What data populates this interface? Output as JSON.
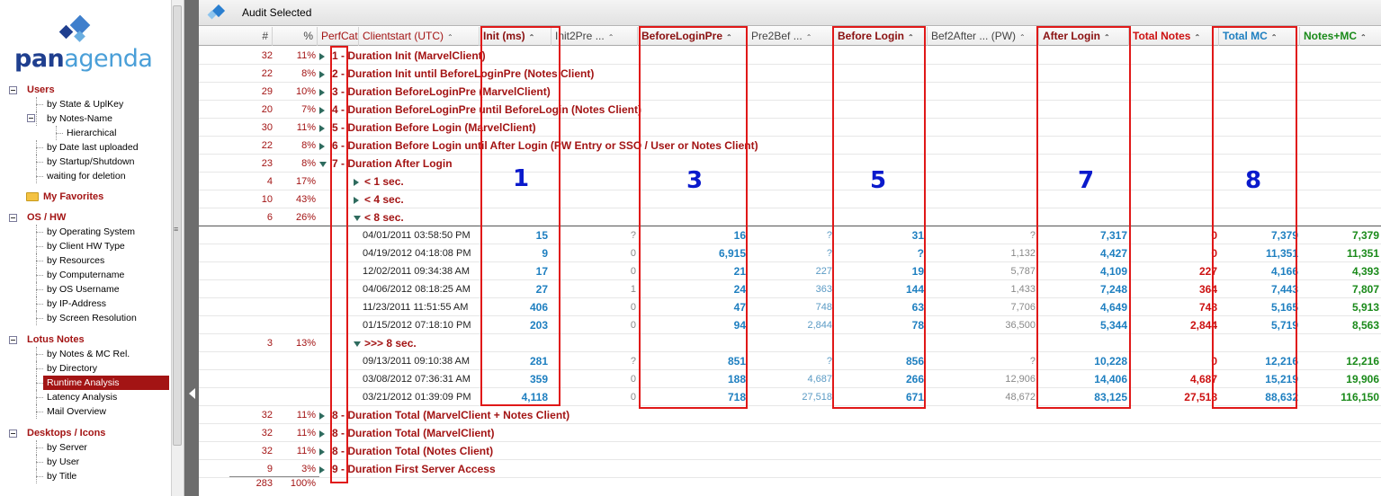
{
  "logo": {
    "part1": "pan",
    "part2": "agenda"
  },
  "nav": {
    "users": {
      "label": "Users",
      "items": [
        "by State & UplKey",
        "by Notes-Name",
        "Hierarchical",
        "by Date last uploaded",
        "by Startup/Shutdown",
        "waiting for deletion"
      ]
    },
    "favorites": "My Favorites",
    "os_hw": {
      "label": "OS / HW",
      "items": [
        "by Operating System",
        "by Client HW Type",
        "by Resources",
        "by Computername",
        "by OS Username",
        "by IP-Address",
        "by Screen Resolution"
      ]
    },
    "lotus": {
      "label": "Lotus Notes",
      "items": [
        "by Notes & MC Rel.",
        "by Directory",
        "Runtime Analysis",
        "Latency Analysis",
        "Mail Overview"
      ]
    },
    "desktops": {
      "label": "Desktops / Icons",
      "items": [
        "by Server",
        "by User",
        "by Title"
      ]
    }
  },
  "toolbar": {
    "title": "Audit Selected"
  },
  "columns": {
    "num": "#",
    "pct": "%",
    "perfcat": "PerfCat",
    "clientstart": "Clientstart (UTC)",
    "init": "Init (ms)",
    "init2pre": "Init2Pre ...",
    "beforeloginpre": "BeforeLoginPre",
    "pre2bef": "Pre2Bef ...",
    "beforelogin": "Before Login",
    "bef2after": "Bef2After ... (PW)",
    "afterlogin": "After Login",
    "totalnotes": "Total Notes",
    "totalmc": "Total MC",
    "notesmc": "Notes+MC"
  },
  "categories": [
    {
      "n": "32",
      "p": "11%",
      "label": "1 - Duration Init (MarvelClient)"
    },
    {
      "n": "22",
      "p": "8%",
      "label": "2 - Duration Init until BeforeLoginPre (Notes Client)"
    },
    {
      "n": "29",
      "p": "10%",
      "label": "3 - Duration BeforeLoginPre (MarvelClient)"
    },
    {
      "n": "20",
      "p": "7%",
      "label": "4 - Duration BeforeLoginPre until BeforeLogin (Notes Client)"
    },
    {
      "n": "30",
      "p": "11%",
      "label": "5 - Duration Before Login (MarvelClient)"
    },
    {
      "n": "22",
      "p": "8%",
      "label": "6 - Duration Before Login until After Login (PW Entry or SSO / User or Notes Client)"
    },
    {
      "n": "23",
      "p": "8%",
      "label": "7 - Duration After Login"
    }
  ],
  "subgroups": [
    {
      "n": "4",
      "p": "17%",
      "label": "< 1 sec."
    },
    {
      "n": "10",
      "p": "43%",
      "label": "< 4 sec."
    },
    {
      "n": "6",
      "p": "26%",
      "label": "< 8 sec."
    }
  ],
  "rows_lt8": [
    {
      "date": "04/01/2011 03:58:50 PM",
      "init": "15",
      "init2": "?",
      "bef": "16",
      "pre2": "?",
      "befl": "31",
      "bef2": "?",
      "after": "7,317",
      "total": "0",
      "mc": "7,379",
      "nmc": "7,379"
    },
    {
      "date": "04/19/2012 04:18:08 PM",
      "init": "9",
      "init2": "0",
      "bef": "6,915",
      "pre2": "?",
      "befl": "?",
      "bef2": "1,132",
      "after": "4,427",
      "total": "0",
      "mc": "11,351",
      "nmc": "11,351"
    },
    {
      "date": "12/02/2011 09:34:38 AM",
      "init": "17",
      "init2": "0",
      "bef": "21",
      "pre2": "227",
      "befl": "19",
      "bef2": "5,787",
      "after": "4,109",
      "total": "227",
      "mc": "4,166",
      "nmc": "4,393"
    },
    {
      "date": "04/06/2012 08:18:25 AM",
      "init": "27",
      "init2": "1",
      "bef": "24",
      "pre2": "363",
      "befl": "144",
      "bef2": "1,433",
      "after": "7,248",
      "total": "364",
      "mc": "7,443",
      "nmc": "7,807"
    },
    {
      "date": "11/23/2011 11:51:55 AM",
      "init": "406",
      "init2": "0",
      "bef": "47",
      "pre2": "748",
      "befl": "63",
      "bef2": "7,706",
      "after": "4,649",
      "total": "748",
      "mc": "5,165",
      "nmc": "5,913"
    },
    {
      "date": "01/15/2012 07:18:10 PM",
      "init": "203",
      "init2": "0",
      "bef": "94",
      "pre2": "2,844",
      "befl": "78",
      "bef2": "36,500",
      "after": "5,344",
      "total": "2,844",
      "mc": "5,719",
      "nmc": "8,563"
    }
  ],
  "group_gt8": {
    "n": "3",
    "p": "13%",
    "label": ">>> 8 sec."
  },
  "rows_gt8": [
    {
      "date": "09/13/2011 09:10:38 AM",
      "init": "281",
      "init2": "?",
      "bef": "851",
      "pre2": "?",
      "befl": "856",
      "bef2": "?",
      "after": "10,228",
      "total": "0",
      "mc": "12,216",
      "nmc": "12,216"
    },
    {
      "date": "03/08/2012 07:36:31 AM",
      "init": "359",
      "init2": "0",
      "bef": "188",
      "pre2": "4,687",
      "befl": "266",
      "bef2": "12,906",
      "after": "14,406",
      "total": "4,687",
      "mc": "15,219",
      "nmc": "19,906"
    },
    {
      "date": "03/21/2012 01:39:09 PM",
      "init": "4,118",
      "init2": "0",
      "bef": "718",
      "pre2": "27,518",
      "befl": "671",
      "bef2": "48,672",
      "after": "83,125",
      "total": "27,518",
      "mc": "88,632",
      "nmc": "116,150"
    }
  ],
  "bottom_categories": [
    {
      "n": "32",
      "p": "11%",
      "label": "8 - Duration Total (MarvelClient + Notes Client)"
    },
    {
      "n": "32",
      "p": "11%",
      "label": "8 - Duration Total (MarvelClient)"
    },
    {
      "n": "32",
      "p": "11%",
      "label": "8 - Duration Total (Notes Client)"
    },
    {
      "n": "9",
      "p": "3%",
      "label": "9 - Duration First Server Access"
    }
  ],
  "footer": {
    "n": "283",
    "p": "100%"
  },
  "annotations": [
    "1",
    "3",
    "5",
    "7",
    "8"
  ],
  "colors": {
    "accent_red": "#a31414",
    "value_blue": "#1e7fc0",
    "total_red": "#cc1111",
    "green": "#1a8a1a",
    "highlight": "#e01818",
    "annotation_blue": "#0a1acc"
  }
}
